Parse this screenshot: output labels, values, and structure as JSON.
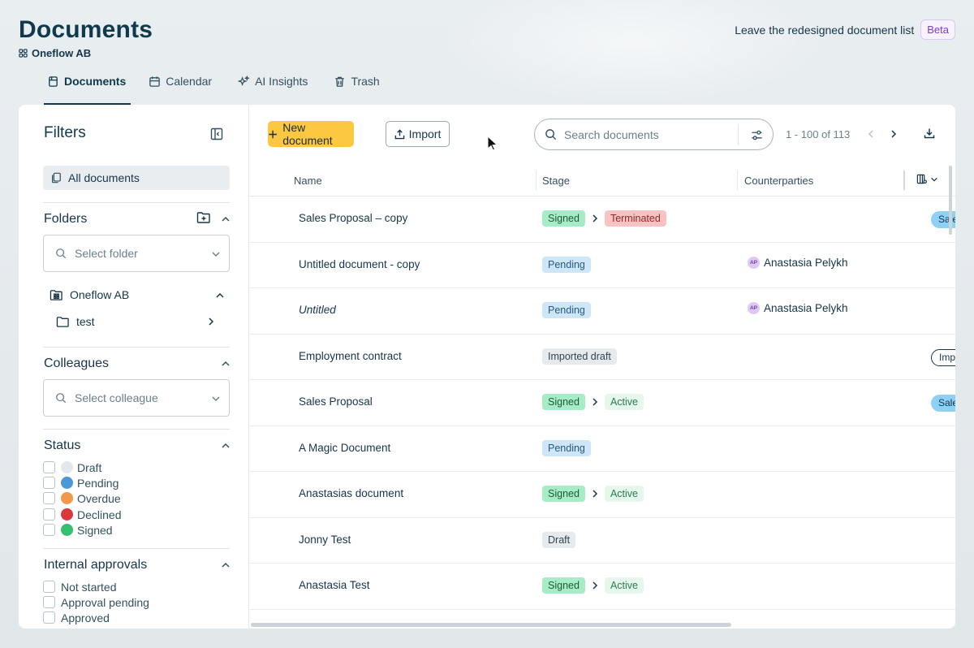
{
  "header": {
    "title": "Documents",
    "org": "Oneflow AB",
    "redesign_text": "Leave the redesigned document list",
    "beta_label": "Beta"
  },
  "tabs": [
    {
      "label": "Documents",
      "icon": "documents-icon",
      "active": true
    },
    {
      "label": "Calendar",
      "icon": "calendar-icon",
      "active": false
    },
    {
      "label": "AI Insights",
      "icon": "sparkle-icon",
      "active": false
    },
    {
      "label": "Trash",
      "icon": "trash-icon",
      "active": false
    }
  ],
  "sidebar": {
    "title": "Filters",
    "all_documents": "All documents",
    "folders": {
      "title": "Folders",
      "placeholder": "Select folder",
      "root": "Oneflow AB",
      "child": "test"
    },
    "colleagues": {
      "title": "Colleagues",
      "placeholder": "Select colleague"
    },
    "status": {
      "title": "Status",
      "items": [
        {
          "label": "Draft",
          "color": "#e4e8ea"
        },
        {
          "label": "Pending",
          "color": "#4a98d6"
        },
        {
          "label": "Overdue",
          "color": "#f0994a"
        },
        {
          "label": "Declined",
          "color": "#d9363e"
        },
        {
          "label": "Signed",
          "color": "#34c06f"
        }
      ]
    },
    "internal_approvals": {
      "title": "Internal approvals",
      "items": [
        "Not started",
        "Approval pending",
        "Approved"
      ]
    }
  },
  "toolbar": {
    "new_document": "New document",
    "import": "Import",
    "search_placeholder": "Search documents",
    "pagination": "1 - 100 of 113"
  },
  "table": {
    "columns": [
      "Name",
      "Stage",
      "Counterparties"
    ],
    "rows": [
      {
        "name": "Sales Proposal – copy",
        "italic": false,
        "stage": [
          "Signed",
          "Terminated"
        ],
        "counterparty": "",
        "tag": "Sale"
      },
      {
        "name": "Untitled document - copy",
        "italic": false,
        "stage": [
          "Pending"
        ],
        "counterparty": "Anastasia Pelykh",
        "avatar": "AP",
        "tag": ""
      },
      {
        "name": "Untitled",
        "italic": true,
        "stage": [
          "Pending"
        ],
        "counterparty": "Anastasia Pelykh",
        "avatar": "AP",
        "tag": ""
      },
      {
        "name": "Employment contract",
        "italic": false,
        "stage": [
          "Imported draft"
        ],
        "counterparty": "",
        "tag": "Imp"
      },
      {
        "name": "Sales Proposal",
        "italic": false,
        "stage": [
          "Signed",
          "Active"
        ],
        "counterparty": "",
        "tag": "Sale"
      },
      {
        "name": "A Magic Document",
        "italic": false,
        "stage": [
          "Pending"
        ],
        "counterparty": "",
        "tag": ""
      },
      {
        "name": "Anastasias document",
        "italic": false,
        "stage": [
          "Signed",
          "Active"
        ],
        "counterparty": "",
        "tag": ""
      },
      {
        "name": "Jonny Test",
        "italic": false,
        "stage": [
          "Draft"
        ],
        "counterparty": "",
        "tag": ""
      },
      {
        "name": "Anastasia Test",
        "italic": false,
        "stage": [
          "Signed",
          "Active"
        ],
        "counterparty": "",
        "tag": ""
      }
    ]
  }
}
